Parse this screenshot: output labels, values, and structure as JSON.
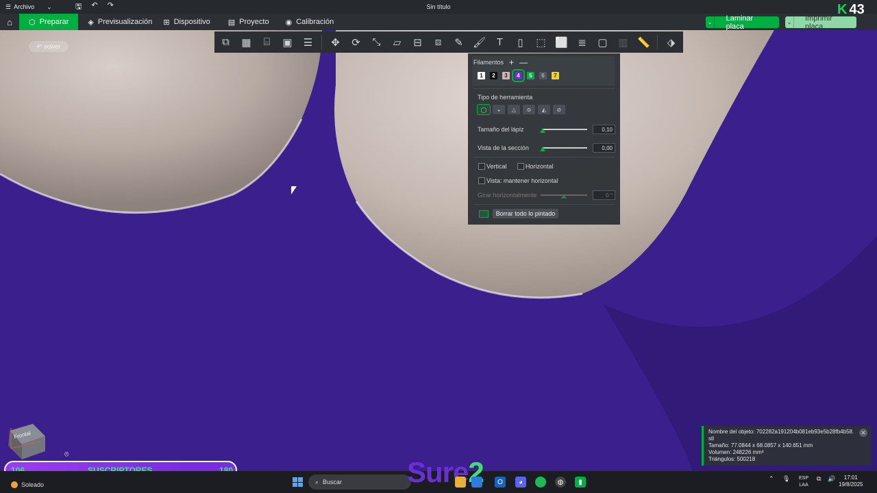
{
  "titlebar": {
    "menu_label": "Archivo",
    "window_title": "Sin título"
  },
  "nav": {
    "tabs": [
      {
        "label": "Preparar",
        "active": true
      },
      {
        "label": "Previsualización"
      },
      {
        "label": "Dispositivo"
      },
      {
        "label": "Proyecto"
      },
      {
        "label": "Calibración"
      }
    ],
    "slice_button": "Laminar placa",
    "print_button": "Imprimir placa"
  },
  "overlay_counter": "43",
  "viewport": {
    "back_label": "volver"
  },
  "paint_panel": {
    "filaments_label": "Filamentos",
    "add_symbol": "+",
    "remove_symbol": "—",
    "filaments": [
      {
        "n": "1",
        "color": "#ffffff"
      },
      {
        "n": "2",
        "color": "#111111"
      },
      {
        "n": "3",
        "color": "#cbb5b5"
      },
      {
        "n": "4",
        "color": "#6a2fd9"
      },
      {
        "n": "5",
        "color": "#00ae42"
      },
      {
        "n": "6",
        "color": "#505560"
      },
      {
        "n": "7",
        "color": "#f5d31a"
      }
    ],
    "selected_filament": "4",
    "tool_type_label": "Tipo de herramienta",
    "pen_size_label": "Tamaño del lápiz",
    "pen_size_value": "0,10",
    "section_view_label": "Vista de la sección",
    "section_view_value": "0,00",
    "vertical_label": "Vertical",
    "horizontal_label": "Horizontal",
    "keep_horizontal_label": "Vista: mantener horizontal",
    "rotate_label": "Girar horizontalmente",
    "rotate_value": "0 °",
    "clear_button": "Borrar todo lo pintado"
  },
  "object_info": {
    "name": "Nombre del objeto: 702282a191204b081eb93e5b28fb4b58.stl",
    "size": "Tamaño: 77.0844 x 68.0857 x 140.651 mm",
    "volume": "Volumen: 248226 mm³",
    "triangles": "Triángulos: 500218"
  },
  "navcube": {
    "front": "Frontal"
  },
  "subscriber_bar": {
    "current": "106",
    "label": "SUSCRIPTORES",
    "goal": "180",
    "progress_fraction": 0.79
  },
  "taskbar": {
    "weather": "Soleado",
    "search_placeholder": "Buscar",
    "brand_text_a": "Sure",
    "brand_text_b": "2",
    "lang": "ESP",
    "lang_sub": "LAA",
    "time": "17:01",
    "date": "19/8/2025"
  }
}
